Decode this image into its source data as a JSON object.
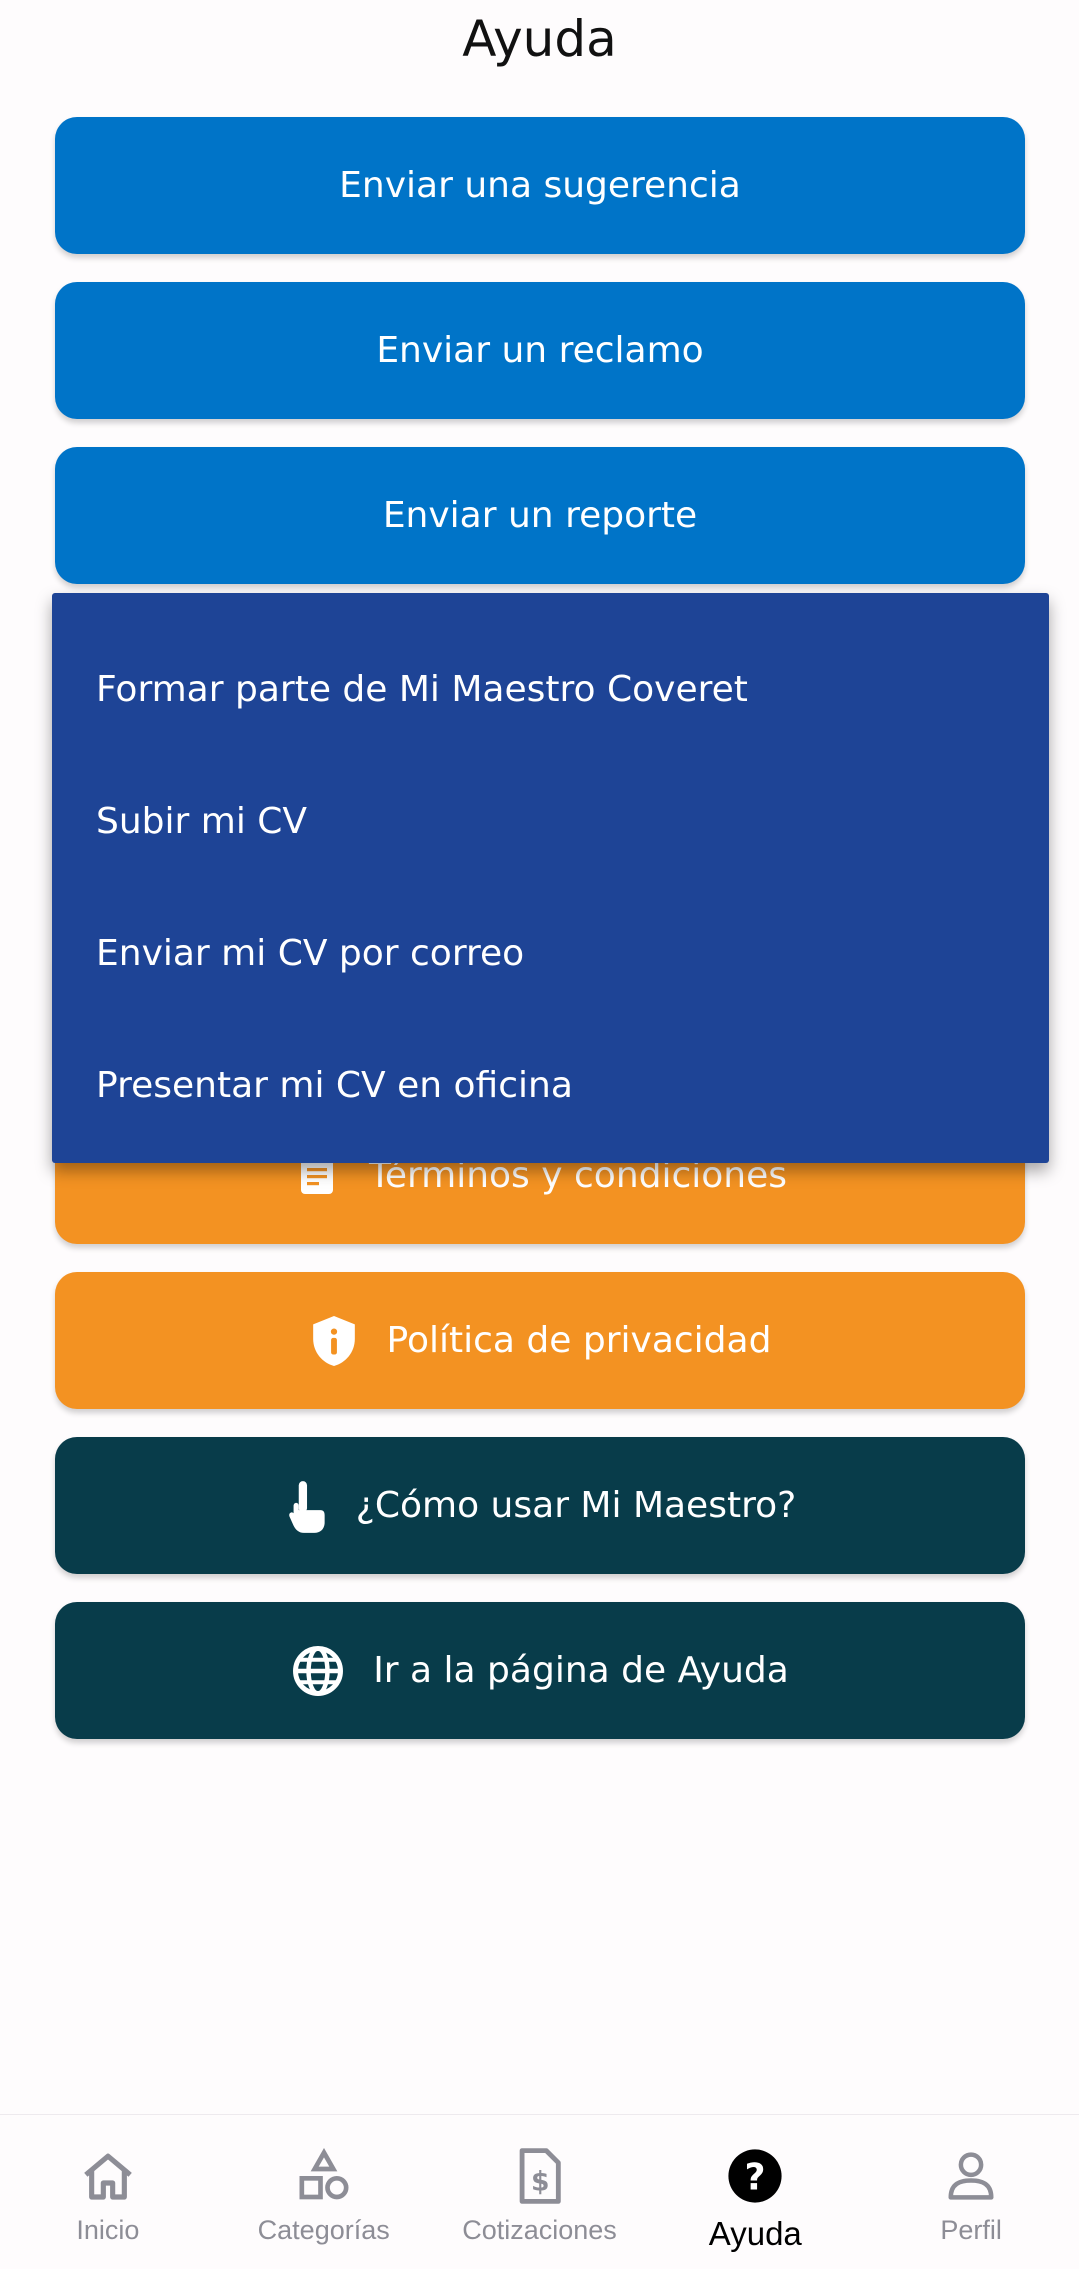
{
  "header": {
    "title": "Ayuda"
  },
  "buttons": {
    "sugerencia": "Enviar una sugerencia",
    "reclamo": "Enviar un reclamo",
    "reporte": "Enviar un reporte",
    "terminos": "Términos y condiciones",
    "privacidad": "Política de privacidad",
    "como_usar": "¿Cómo usar Mi Maestro?",
    "pagina_ayuda": "Ir a la página de Ayuda"
  },
  "dropdown": {
    "items": [
      {
        "label": "Formar parte de Mi Maestro Coveret"
      },
      {
        "label": "Subir mi CV"
      },
      {
        "label": "Enviar mi CV por correo"
      },
      {
        "label": "Presentar mi CV en oficina"
      }
    ]
  },
  "nav": {
    "items": [
      {
        "label": "Inicio",
        "icon": "home-icon"
      },
      {
        "label": "Categorías",
        "icon": "shapes-icon"
      },
      {
        "label": "Cotizaciones",
        "icon": "document-dollar-icon"
      },
      {
        "label": "Ayuda",
        "icon": "help-circle-icon",
        "active": true
      },
      {
        "label": "Perfil",
        "icon": "person-icon"
      }
    ]
  },
  "colors": {
    "blue": "#0074c8",
    "orange": "#f39222",
    "teal": "#083c4a",
    "dropdown": "#1e4496"
  }
}
